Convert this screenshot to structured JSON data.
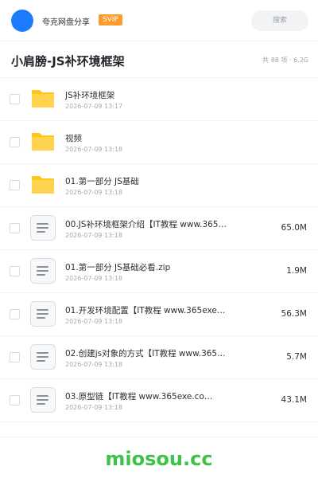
{
  "header": {
    "brand": "夸克网盘分享",
    "badge": "SVIP",
    "search_placeholder": "搜索"
  },
  "folder": {
    "title": "小肩膀-JS补环境框架",
    "meta": "共 88 项 · 6.2G"
  },
  "files": [
    {
      "type": "folder",
      "name": "JS补环境框架",
      "date": "2026-07-09 13:17",
      "size": ""
    },
    {
      "type": "folder",
      "name": "视频",
      "date": "2026-07-09 13:18",
      "size": ""
    },
    {
      "type": "folder",
      "name": "01.第一部分 JS基础",
      "date": "2026-07-09 13:18",
      "size": ""
    },
    {
      "type": "file",
      "name": "00.JS补环境框架介绍【IT教程 www.365…",
      "date": "2026-07-09 13:18",
      "size": "65.0M"
    },
    {
      "type": "file",
      "name": "01.第一部分 JS基础必看.zip",
      "date": "2026-07-09 13:18",
      "size": "1.9M"
    },
    {
      "type": "file",
      "name": "01.开发环境配置【IT教程 www.365exe…",
      "date": "2026-07-09 13:18",
      "size": "56.3M"
    },
    {
      "type": "file",
      "name": "02.创建js对象的方式【IT教程 www.365…",
      "date": "2026-07-09 13:18",
      "size": "5.7M"
    },
    {
      "type": "file",
      "name": "03.原型链【IT教程 www.365exe.co…",
      "date": "2026-07-09 13:18",
      "size": "43.1M"
    }
  ],
  "watermark": "miosou.cc",
  "colors": {
    "avatar": "#1d7bff",
    "badge": "#ff9a2e",
    "folder": "#ffc61a",
    "watermark": "#3ec24a"
  }
}
